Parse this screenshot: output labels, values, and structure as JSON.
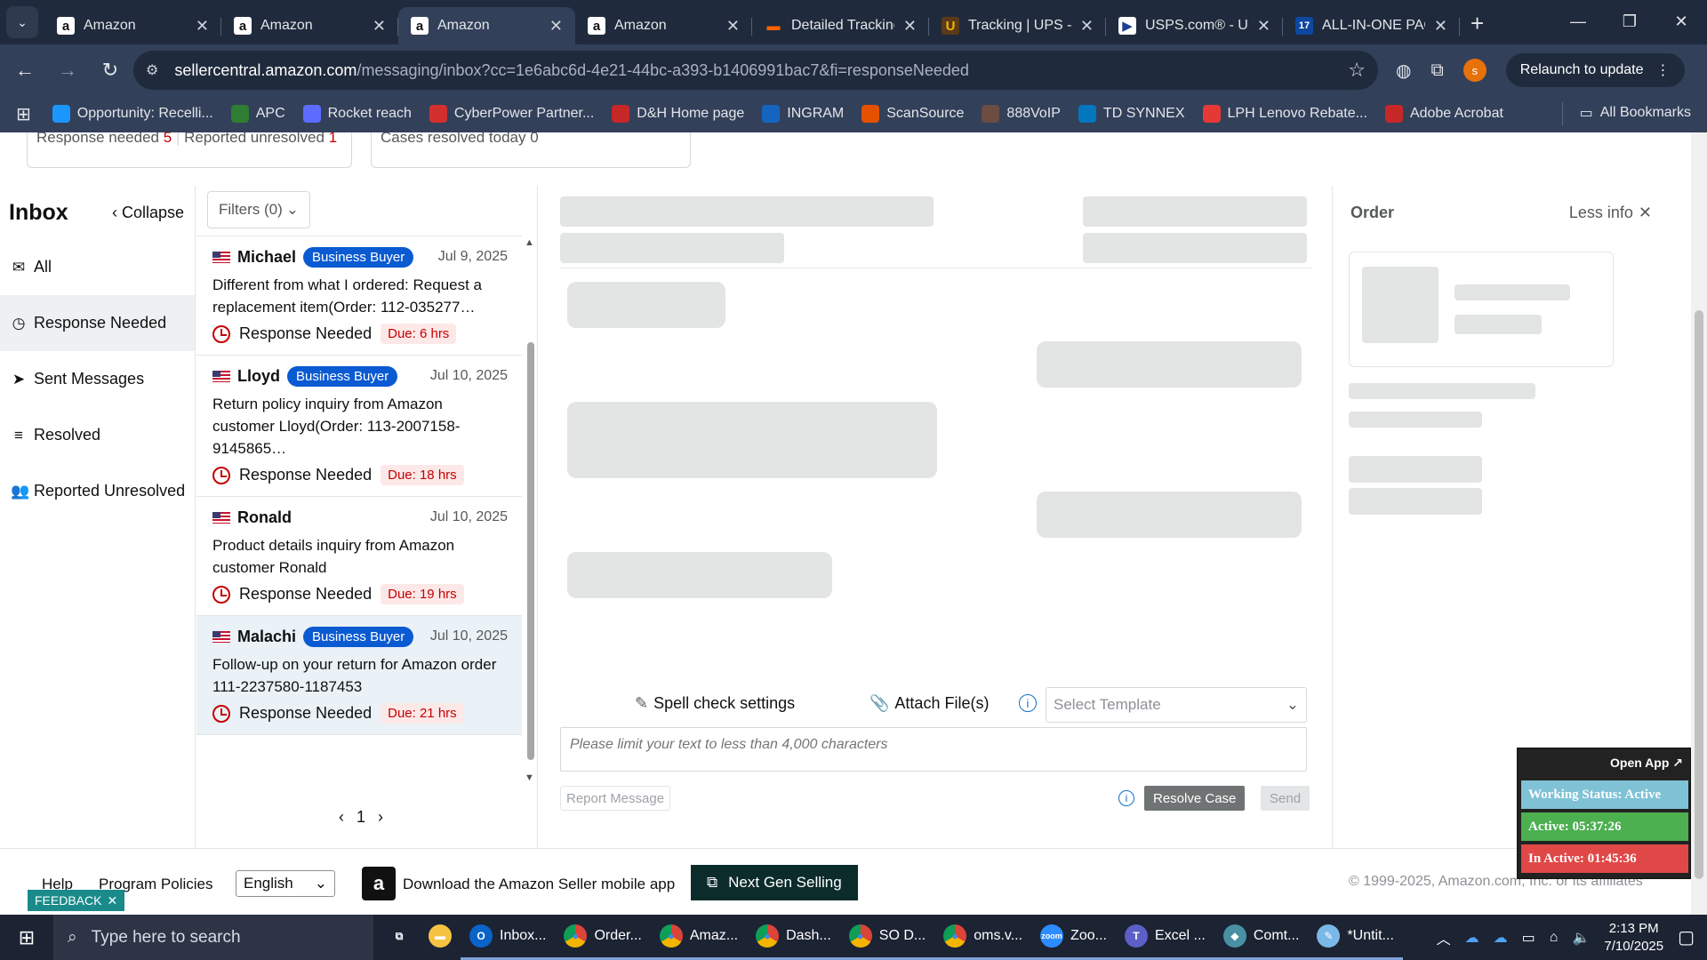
{
  "browser": {
    "tabs": [
      {
        "title": "Amazon",
        "icon": "amazon-icon",
        "active": false
      },
      {
        "title": "Amazon",
        "icon": "amazon-icon",
        "active": false
      },
      {
        "title": "Amazon",
        "icon": "amazon-icon",
        "active": true
      },
      {
        "title": "Amazon",
        "icon": "amazon-icon",
        "active": false
      },
      {
        "title": "Detailed Tracking",
        "icon": "fedex-icon",
        "active": false
      },
      {
        "title": "Tracking | UPS - U",
        "icon": "ups-icon",
        "active": false
      },
      {
        "title": "USPS.com® - US",
        "icon": "usps-icon",
        "active": false
      },
      {
        "title": "ALL-IN-ONE PAC",
        "icon": "17track-icon",
        "active": false
      }
    ],
    "url_host": "sellercentral.amazon.com",
    "url_path": "/messaging/inbox?cc=1e6abc6d-4e21-44bc-a393-b1406991bac7&fi=responseNeeded",
    "profile_initial": "s",
    "relaunch_label": "Relaunch to update",
    "bookmarks": [
      {
        "label": "Opportunity: Recelli...",
        "color": "#1b96ff",
        "glyph": ""
      },
      {
        "label": "APC",
        "color": "#2e7d32",
        "glyph": "⚡"
      },
      {
        "label": "Rocket reach",
        "color": "#5b6cff",
        "glyph": "🚀"
      },
      {
        "label": "CyberPower Partner...",
        "color": "#d32f2f",
        "glyph": "CP"
      },
      {
        "label": "D&H Home page",
        "color": "#c62828",
        "glyph": "D"
      },
      {
        "label": "INGRAM",
        "color": "#1565c0",
        "glyph": "G"
      },
      {
        "label": "ScanSource",
        "color": "#e65100",
        "glyph": "S"
      },
      {
        "label": "888VoIP",
        "color": "#6d4c41",
        "glyph": "8"
      },
      {
        "label": "TD SYNNEX",
        "color": "#0277bd",
        "glyph": "EC"
      },
      {
        "label": "LPH Lenovo Rebate...",
        "color": "#e53935",
        "glyph": "L"
      },
      {
        "label": "Adobe Acrobat",
        "color": "#c62828",
        "glyph": "A"
      }
    ],
    "all_bookmarks_label": "All Bookmarks"
  },
  "stats": {
    "response_needed_label": "Response needed",
    "response_needed_count": "5",
    "reported_unresolved_label": "Reported unresolved",
    "reported_unresolved_count": "1",
    "resolved_today_label": "Cases resolved today 0"
  },
  "inbox": {
    "title": "Inbox",
    "collapse_label": "Collapse",
    "nav": [
      {
        "label": "All",
        "icon": "mail-icon",
        "glyph": "✉",
        "active": false
      },
      {
        "label": "Response Needed",
        "icon": "clock-icon",
        "glyph": "◷",
        "active": true
      },
      {
        "label": "Sent Messages",
        "icon": "send-icon",
        "glyph": "➤",
        "active": false
      },
      {
        "label": "Resolved",
        "icon": "resolved-list-icon",
        "glyph": "≡",
        "active": false
      },
      {
        "label": "Reported Unresolved",
        "icon": "users-icon",
        "glyph": "👥",
        "active": false
      }
    ]
  },
  "messages": {
    "filters_label": "Filters (0)",
    "items": [
      {
        "name": "Michael",
        "badge": "Business Buyer",
        "date": "Jul 9, 2025",
        "subject": "Different from what I ordered: Request a replacement item(Order: 112-035277…",
        "status": "Response Needed",
        "due": "Due: 6 hrs",
        "selected": false
      },
      {
        "name": "Lloyd",
        "badge": "Business Buyer",
        "date": "Jul 10, 2025",
        "subject": "Return policy inquiry from Amazon customer Lloyd(Order: 113-2007158-9145865…",
        "status": "Response Needed",
        "due": "Due: 18 hrs",
        "selected": false
      },
      {
        "name": "Ronald",
        "badge": "",
        "date": "Jul 10, 2025",
        "subject": "Product details inquiry from Amazon customer Ronald",
        "status": "Response Needed",
        "due": "Due: 19 hrs",
        "selected": false
      },
      {
        "name": "Malachi",
        "badge": "Business Buyer",
        "date": "Jul 10, 2025",
        "subject": "Follow-up on your return for Amazon order 111-2237580-1187453",
        "status": "Response Needed",
        "due": "Due: 21 hrs",
        "selected": true
      }
    ],
    "page": "1"
  },
  "composer": {
    "spell_check_label": "Spell check settings",
    "attach_label": "Attach File(s)",
    "template_placeholder": "Select Template",
    "reply_placeholder": "Please limit your text to less than 4,000 characters",
    "report_label": "Report Message",
    "resolve_label": "Resolve Case",
    "send_label": "Send"
  },
  "order_panel": {
    "title": "Order",
    "less_info_label": "Less info"
  },
  "footer": {
    "help": "Help",
    "policies": "Program Policies",
    "language": "English",
    "download": "Download the Amazon Seller mobile app",
    "next_gen": "Next Gen Selling",
    "copyright": "© 1999-2025, Amazon.com, Inc. or its affiliates",
    "feedback": "FEEDBACK"
  },
  "widget": {
    "open_app": "Open App ↗",
    "working_status": "Working Status: Active",
    "active": "Active: 05:37:26",
    "inactive": "In Active: 01:45:36"
  },
  "taskbar": {
    "search_placeholder": "Type here to search",
    "apps": [
      {
        "label": "",
        "icon": "task-view-icon",
        "color": "transparent",
        "glyph": "⧉"
      },
      {
        "label": "",
        "icon": "file-explorer-icon",
        "color": "#f6c343",
        "glyph": "▬"
      },
      {
        "label": "Inbox...",
        "icon": "outlook-icon",
        "color": "#0a64c8",
        "glyph": "O"
      },
      {
        "label": "Order...",
        "icon": "chrome-icon",
        "color": "#db4437",
        "glyph": "●"
      },
      {
        "label": "Amaz...",
        "icon": "chrome-icon",
        "color": "#db4437",
        "glyph": "●"
      },
      {
        "label": "Dash...",
        "icon": "chrome-icon",
        "color": "#db4437",
        "glyph": "●"
      },
      {
        "label": "SO D...",
        "icon": "chrome-icon",
        "color": "#db4437",
        "glyph": "●"
      },
      {
        "label": "oms.v...",
        "icon": "chrome-icon",
        "color": "#db4437",
        "glyph": "●"
      },
      {
        "label": "Zoo...",
        "icon": "zoom-icon",
        "color": "#2d8cff",
        "glyph": "zoom"
      },
      {
        "label": "Excel ...",
        "icon": "teams-icon",
        "color": "#5b5fc7",
        "glyph": "T"
      },
      {
        "label": "Comt...",
        "icon": "comtrade-icon",
        "color": "#4a90a4",
        "glyph": "◆"
      },
      {
        "label": "*Untit...",
        "icon": "notepad-icon",
        "color": "#7ab8e8",
        "glyph": "✎"
      }
    ],
    "time": "2:13 PM",
    "date": "7/10/2025"
  }
}
